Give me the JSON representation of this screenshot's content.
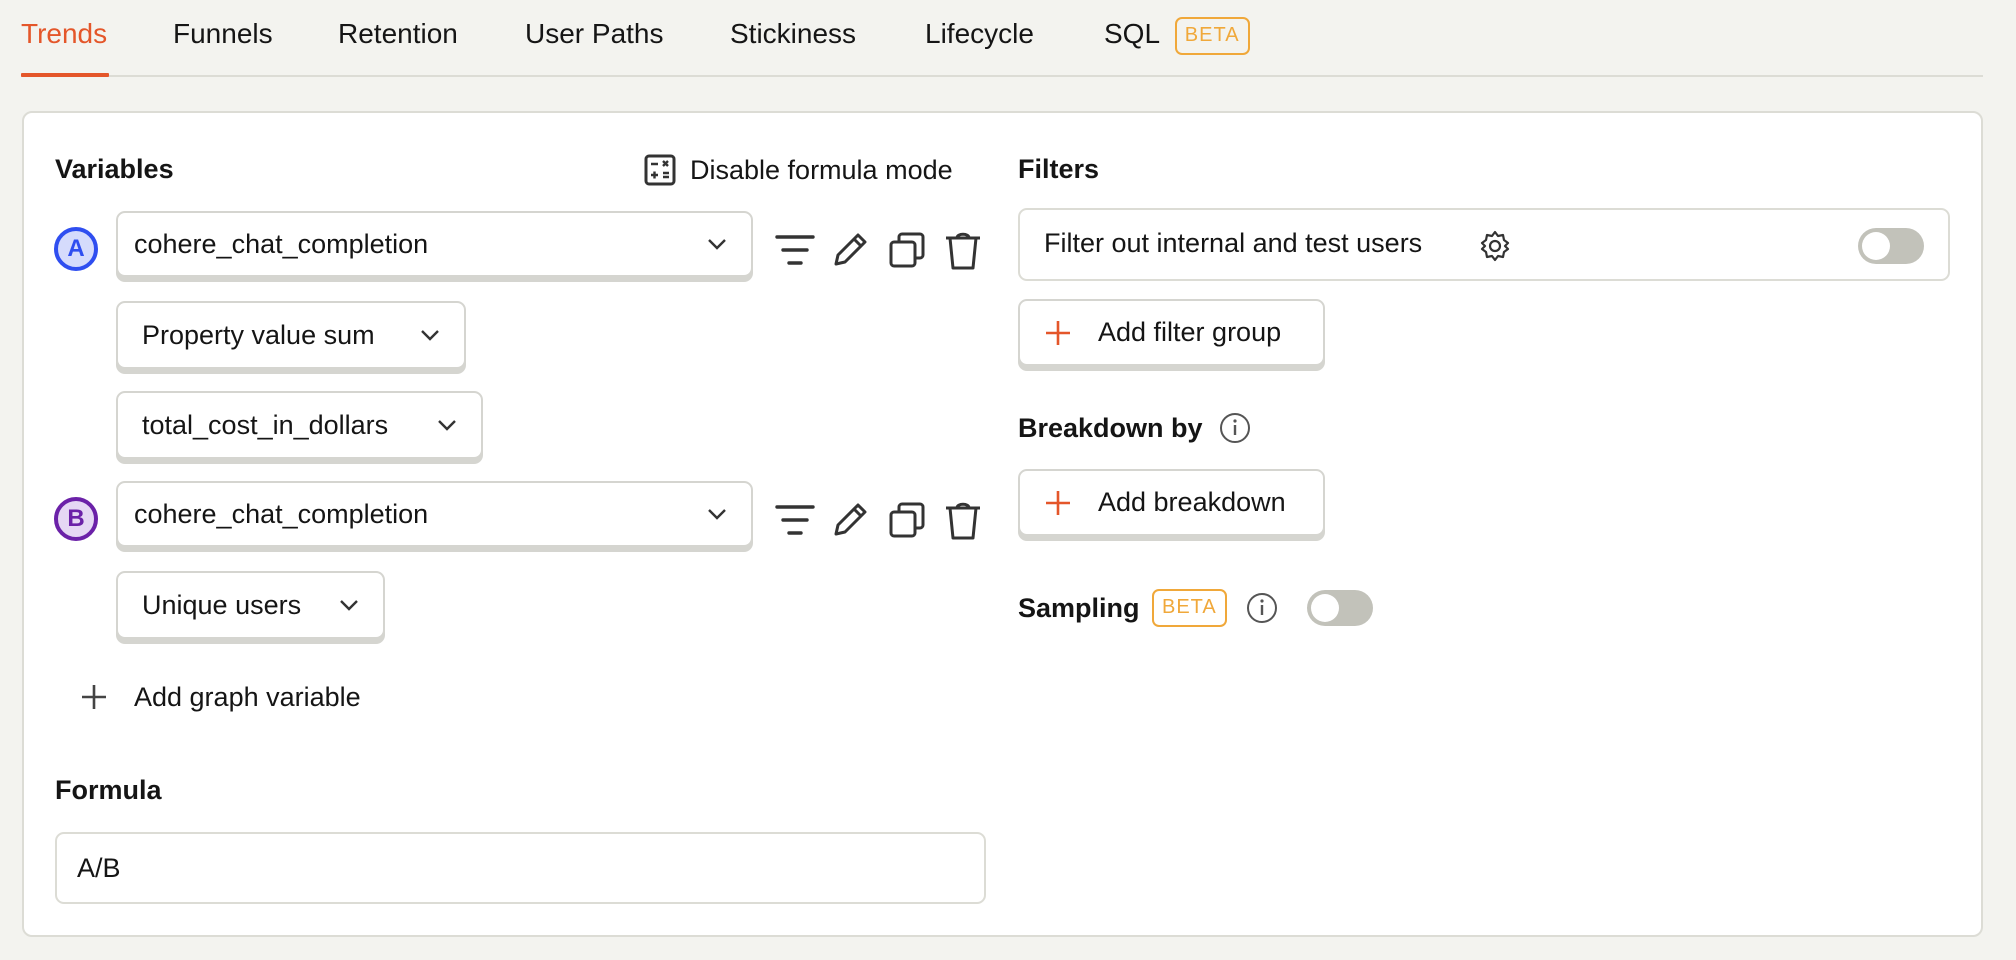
{
  "tabs": [
    {
      "label": "Trends",
      "active": true
    },
    {
      "label": "Funnels",
      "active": false
    },
    {
      "label": "Retention",
      "active": false
    },
    {
      "label": "User Paths",
      "active": false
    },
    {
      "label": "Stickiness",
      "active": false
    },
    {
      "label": "Lifecycle",
      "active": false
    },
    {
      "label": "SQL",
      "active": false,
      "badge": "BETA"
    }
  ],
  "colors": {
    "accent": "#e4562a",
    "beta": "#f0a83a",
    "series_a": "#2f4ef0",
    "series_b": "#6b21a8"
  },
  "variables": {
    "heading": "Variables",
    "formula_mode_button": {
      "label": "Disable formula mode",
      "icon": "calculator-icon"
    },
    "series": [
      {
        "letter": "A",
        "event": "cohere_chat_completion",
        "math": "Property value sum",
        "property": "total_cost_in_dollars"
      },
      {
        "letter": "B",
        "event": "cohere_chat_completion",
        "math": "Unique users"
      }
    ],
    "row_actions": [
      "filter-icon",
      "pencil-icon",
      "copy-icon",
      "trash-icon"
    ],
    "add_button": "Add graph variable"
  },
  "formula": {
    "heading": "Formula",
    "value": "A/B"
  },
  "filters": {
    "heading": "Filters",
    "test_users_label": "Filter out internal and test users",
    "test_users_enabled": false,
    "add_filter_group": "Add filter group"
  },
  "breakdown": {
    "heading": "Breakdown by",
    "add_button": "Add breakdown"
  },
  "sampling": {
    "heading": "Sampling",
    "badge": "BETA",
    "enabled": false
  }
}
